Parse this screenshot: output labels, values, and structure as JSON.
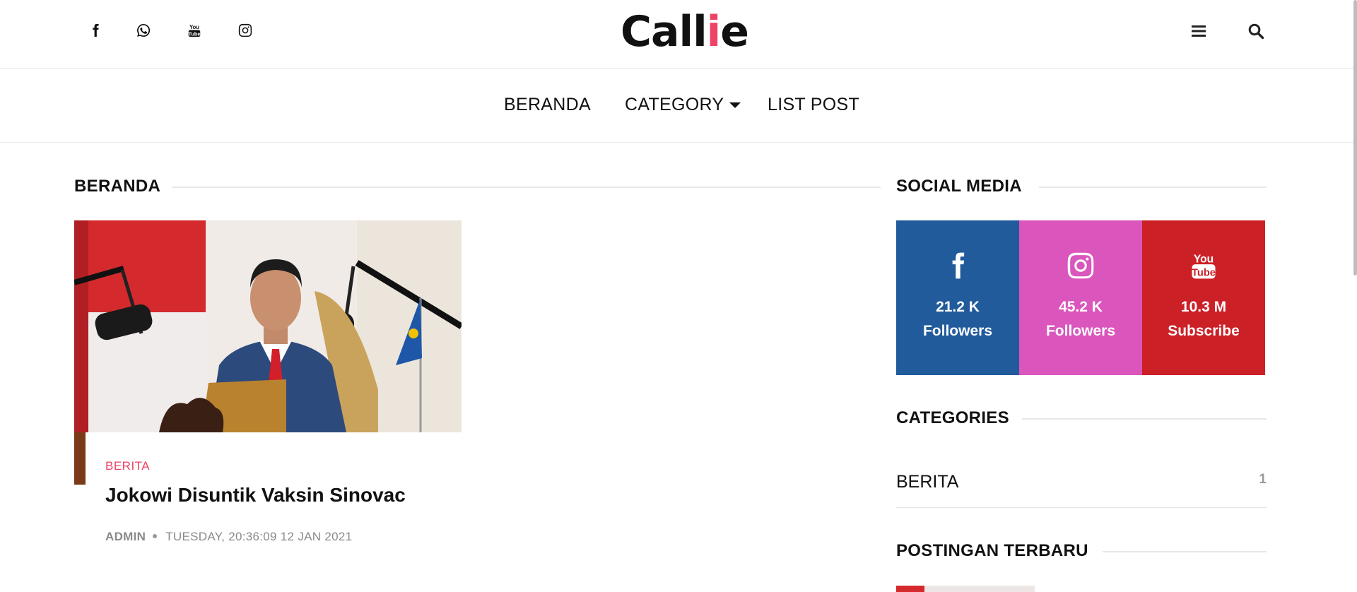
{
  "header": {
    "logo_main": "Call",
    "logo_accent": "i",
    "logo_end": "e",
    "accent_color": "#ee4266"
  },
  "nav": {
    "items": [
      {
        "label": "BERANDA"
      },
      {
        "label": "CATEGORY"
      },
      {
        "label": "LIST POST"
      }
    ]
  },
  "main": {
    "section_title": "BERANDA",
    "post": {
      "category": "BERITA",
      "title": "Jokowi Disuntik Vaksin Sinovac",
      "author": "ADMIN",
      "date": "TUESDAY, 20:36:09 12 JAN 2021"
    }
  },
  "sidebar": {
    "social_title": "SOCIAL MEDIA",
    "social": [
      {
        "icon": "facebook-icon",
        "count": "21.2 K",
        "label": "Followers",
        "color": "#225b9c"
      },
      {
        "icon": "instagram-icon",
        "count": "45.2 K",
        "label": "Followers",
        "color": "#da56bd"
      },
      {
        "icon": "youtube-icon",
        "count": "10.3 M",
        "label": "Subscribe",
        "color": "#cc2027"
      }
    ],
    "categories_title": "CATEGORIES",
    "categories": [
      {
        "name": "BERITA",
        "count": "1"
      }
    ],
    "recent_title": "POSTINGAN TERBARU"
  }
}
